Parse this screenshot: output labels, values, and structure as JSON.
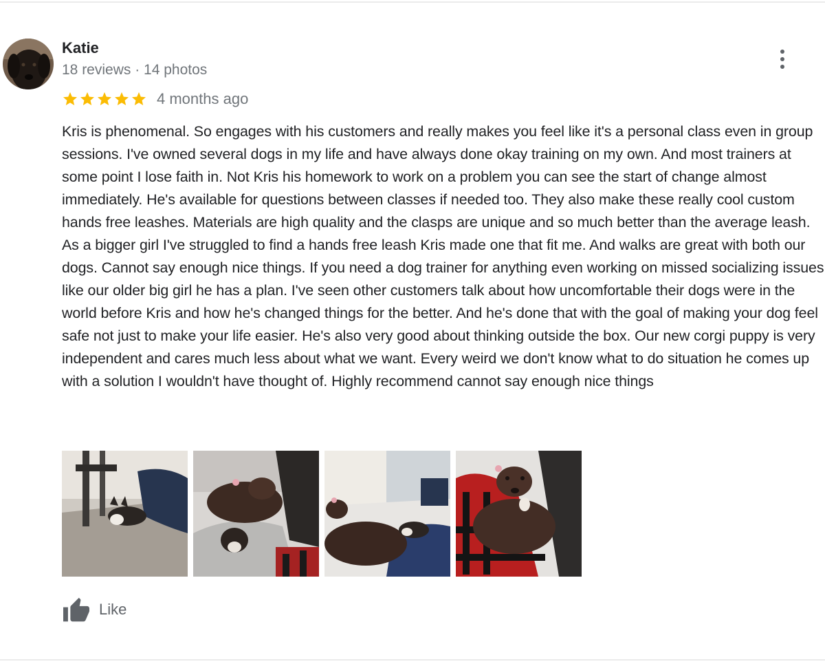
{
  "reviewer": {
    "name": "Katie",
    "meta": "18 reviews · 14 photos"
  },
  "review": {
    "rating": 5,
    "rating_max": 5,
    "date": "4 months ago",
    "text": "Kris is phenomenal. So engages with his customers and really makes you feel like it's a personal class even in group sessions. I've owned several dogs in my life and have always done okay training on my own. And most trainers at some point I lose faith in. Not Kris his homework to work on a problem you can see the start of change almost immediately. He's available for questions between classes if needed too. They also make these really cool custom hands free leashes. Materials are high quality and the clasps are unique and so much better than the average leash. As a bigger girl I've struggled to find a hands free leash Kris made one that fit me. And walks are great with both our dogs. Cannot say enough nice things. If you need a dog trainer for anything even working on missed socializing issues like our older big girl he has a plan. I've seen other customers talk about how uncomfortable their dogs were in the world before Kris and how he's changed things for the better. And he's done that with the goal of making your dog feel safe not just to make your life easier. He's also very good about thinking outside the box. Our new corgi puppy is very independent and cares much less about what we want. Every weird we don't know what to do situation he comes up with a solution I wouldn't have thought of. Highly recommend cannot say enough nice things"
  },
  "photos_count": 4,
  "actions": {
    "like_label": "Like"
  },
  "icons": {
    "more": "more-vert-icon",
    "star": "star-icon",
    "like": "thumb-up-icon"
  },
  "colors": {
    "star": "#fbbc04",
    "meta_text": "#70757a",
    "body_text": "#202124",
    "icon": "#5f6368"
  }
}
